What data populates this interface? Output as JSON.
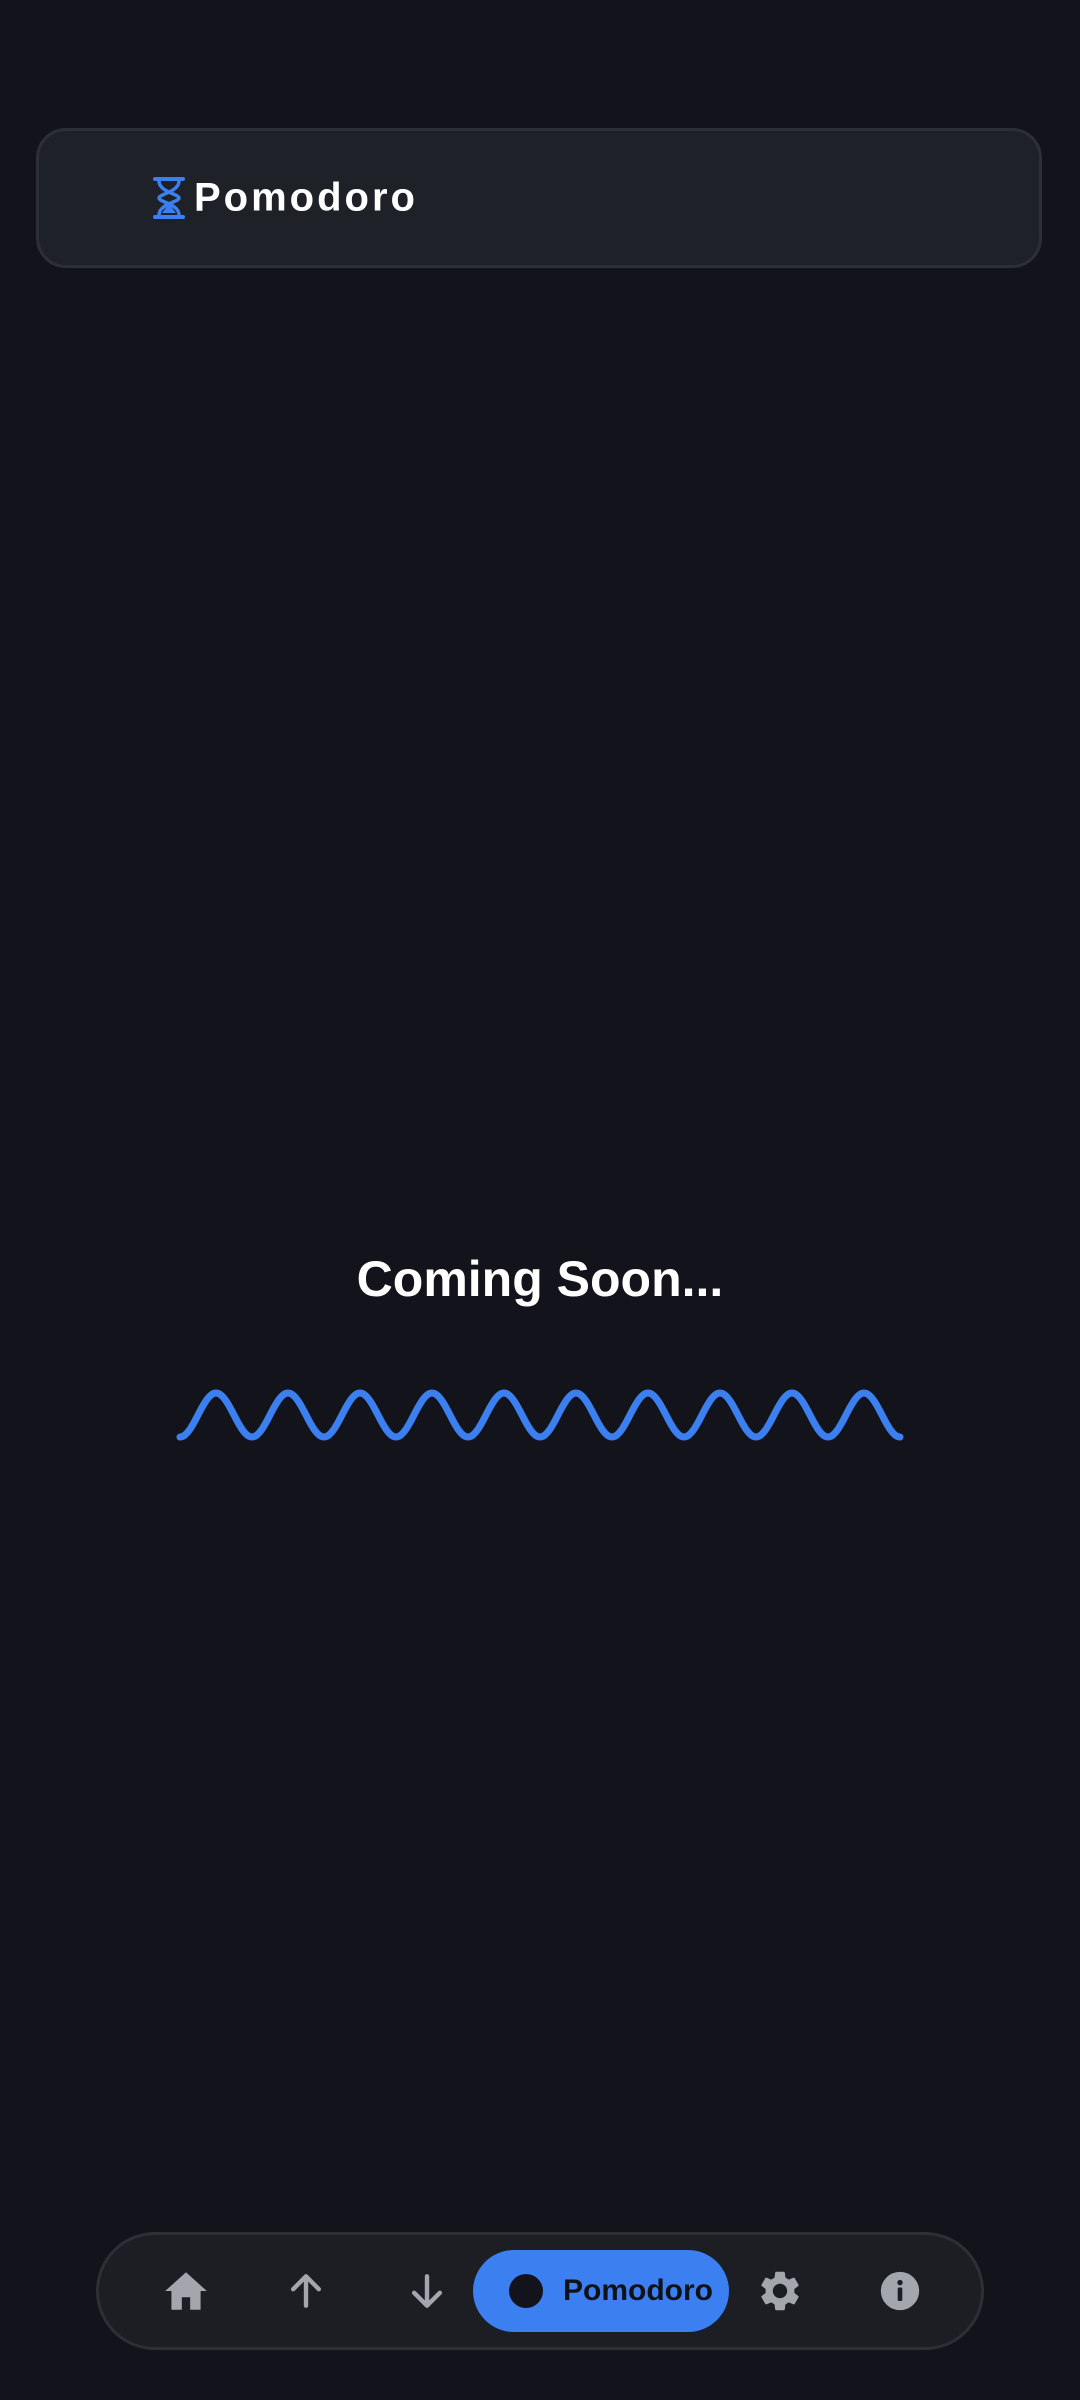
{
  "header": {
    "title": "Pomodoro",
    "icon": "hourglass-icon"
  },
  "main": {
    "message": "Coming Soon..."
  },
  "bottom_nav": {
    "items": [
      {
        "icon": "home-icon"
      },
      {
        "icon": "arrow-up-icon"
      },
      {
        "icon": "arrow-down-icon"
      },
      {
        "icon": "dot-icon",
        "label": "Pomodoro",
        "active": true
      },
      {
        "icon": "gear-icon"
      },
      {
        "icon": "info-icon"
      }
    ]
  },
  "colors": {
    "background": "#13141b",
    "card": "#1e2128",
    "accent": "#3b7ff0",
    "icon_muted": "#a3a6ad",
    "text": "#ffffff"
  }
}
